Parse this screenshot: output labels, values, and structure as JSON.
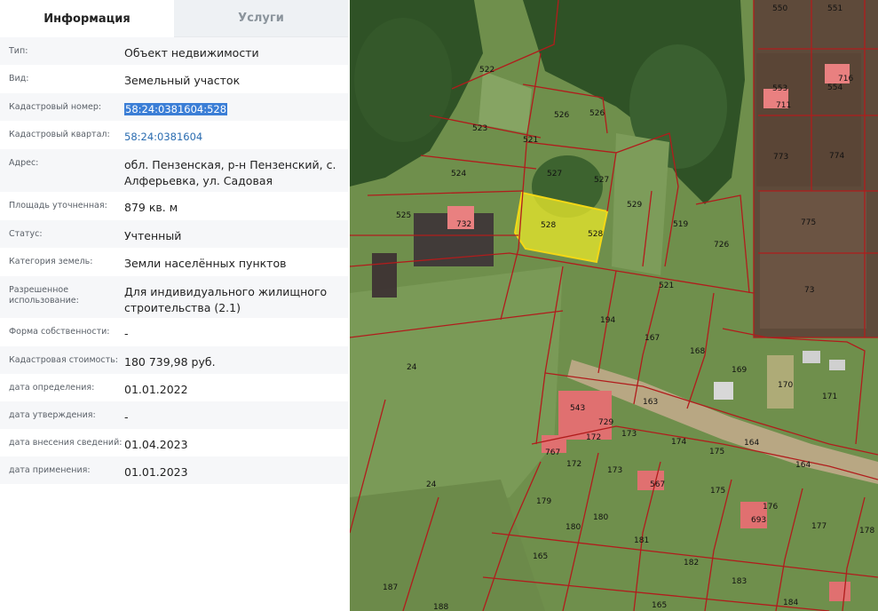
{
  "tabs": {
    "info": "Информация",
    "services": "Услуги"
  },
  "fields": [
    {
      "label": "Тип:",
      "value": "Объект недвижимости"
    },
    {
      "label": "Вид:",
      "value": "Земельный участок"
    },
    {
      "label": "Кадастровый номер:",
      "value": "58:24:0381604:528"
    },
    {
      "label": "Кадастровый квартал:",
      "value": "58:24:0381604"
    },
    {
      "label": "Адрес:",
      "value": "обл. Пензенская, р-н Пензенский, с. Алферьевка, ул. Садовая"
    },
    {
      "label": "Площадь уточненная:",
      "value": "879 кв. м"
    },
    {
      "label": "Статус:",
      "value": "Учтенный"
    },
    {
      "label": "Категория земель:",
      "value": "Земли населённых пунктов"
    },
    {
      "label": "Разрешенное использование:",
      "value": "Для индивидуального жилищного строительства (2.1)"
    },
    {
      "label": "Форма собственности:",
      "value": "-"
    },
    {
      "label": "Кадастровая стоимость:",
      "value": "180 739,98 руб."
    },
    {
      "label": "дата определения:",
      "value": "01.01.2022"
    },
    {
      "label": "дата утверждения:",
      "value": "-"
    },
    {
      "label": "дата внесения сведений:",
      "value": "01.04.2023"
    },
    {
      "label": "дата применения:",
      "value": "01.01.2023"
    }
  ],
  "map": {
    "plot_labels": [
      "522",
      "526",
      "526",
      "523",
      "521",
      "527",
      "527",
      "524",
      "529",
      "525",
      "732",
      "528",
      "528",
      "519",
      "726",
      "521",
      "194",
      "167",
      "168",
      "24",
      "169",
      "170",
      "171",
      "163",
      "543",
      "729",
      "172",
      "173",
      "174",
      "164",
      "767",
      "172",
      "173",
      "175",
      "164",
      "567",
      "175",
      "176",
      "179",
      "180",
      "693",
      "177",
      "178",
      "24",
      "180",
      "181",
      "182",
      "165",
      "183",
      "187",
      "188",
      "184",
      "165",
      "550",
      "551",
      "553",
      "554",
      "716",
      "711",
      "773",
      "774",
      "775",
      "73"
    ],
    "selected_plot": "528"
  }
}
